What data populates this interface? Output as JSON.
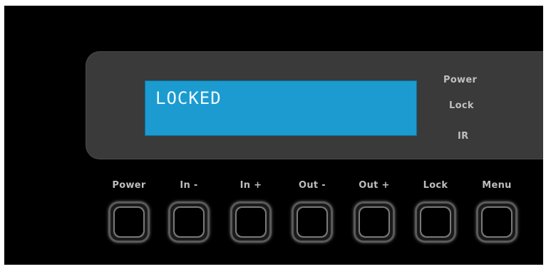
{
  "lcd": {
    "text": "LOCKED"
  },
  "indicators": {
    "power": "Power",
    "lock": "Lock",
    "ir": "IR"
  },
  "buttons": [
    {
      "label": "Power"
    },
    {
      "label": "In -"
    },
    {
      "label": "In +"
    },
    {
      "label": "Out -"
    },
    {
      "label": "Out +"
    },
    {
      "label": "Lock"
    },
    {
      "label": "Menu"
    }
  ],
  "colors": {
    "lcd_background": "#1b9bd0",
    "lcd_text": "#f2fbff",
    "panel": "#3a3a3a",
    "frame": "#000000",
    "label_text": "#bdbdbd"
  }
}
